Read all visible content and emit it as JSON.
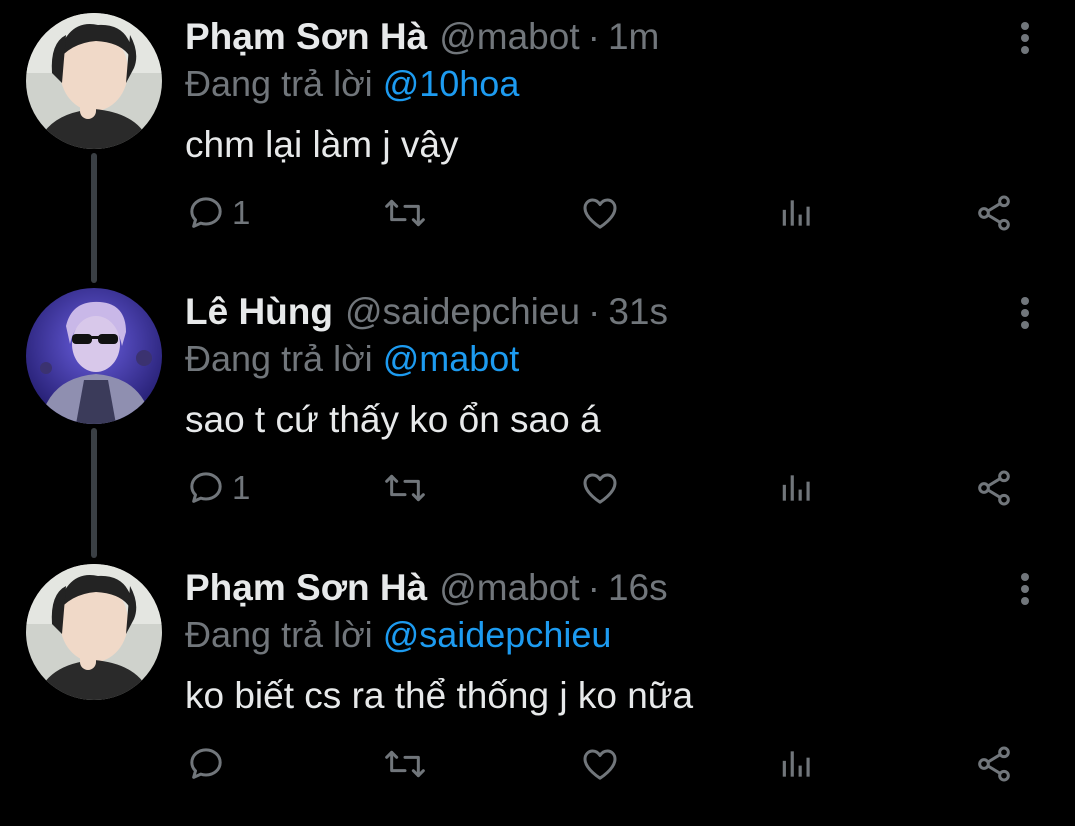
{
  "tweets": [
    {
      "author": "Phạm Sơn Hà",
      "handle": "@mabot",
      "separator": "·",
      "time": "1m",
      "reply_prefix": "Đang trả lời",
      "reply_to": "@10hoa",
      "text": "chm lại làm j vậy",
      "reply_count": "1",
      "avatar": "avatar-pham-son-ha"
    },
    {
      "author": "Lê Hùng",
      "handle": "@saidepchieu",
      "separator": "·",
      "time": "31s",
      "reply_prefix": "Đang trả lời",
      "reply_to": "@mabot",
      "text": "sao t cứ thấy ko ổn sao á",
      "reply_count": "1",
      "avatar": "avatar-le-hung"
    },
    {
      "author": "Phạm Sơn Hà",
      "handle": "@mabot",
      "separator": "·",
      "time": "16s",
      "reply_prefix": "Đang trả lời",
      "reply_to": "@saidepchieu",
      "text": "ko biết cs ra thể thống j ko nữa",
      "reply_count": "",
      "avatar": "avatar-pham-son-ha"
    }
  ],
  "icons": {
    "reply": "reply-icon",
    "retweet": "retweet-icon",
    "like": "heart-icon",
    "analytics": "analytics-icon",
    "share": "share-icon",
    "more": "more-vertical-icon"
  },
  "colors": {
    "background": "#000000",
    "text": "#e7e9ea",
    "secondary": "#71767b",
    "link": "#1d9bf0",
    "thread_line": "#3a3f44"
  }
}
